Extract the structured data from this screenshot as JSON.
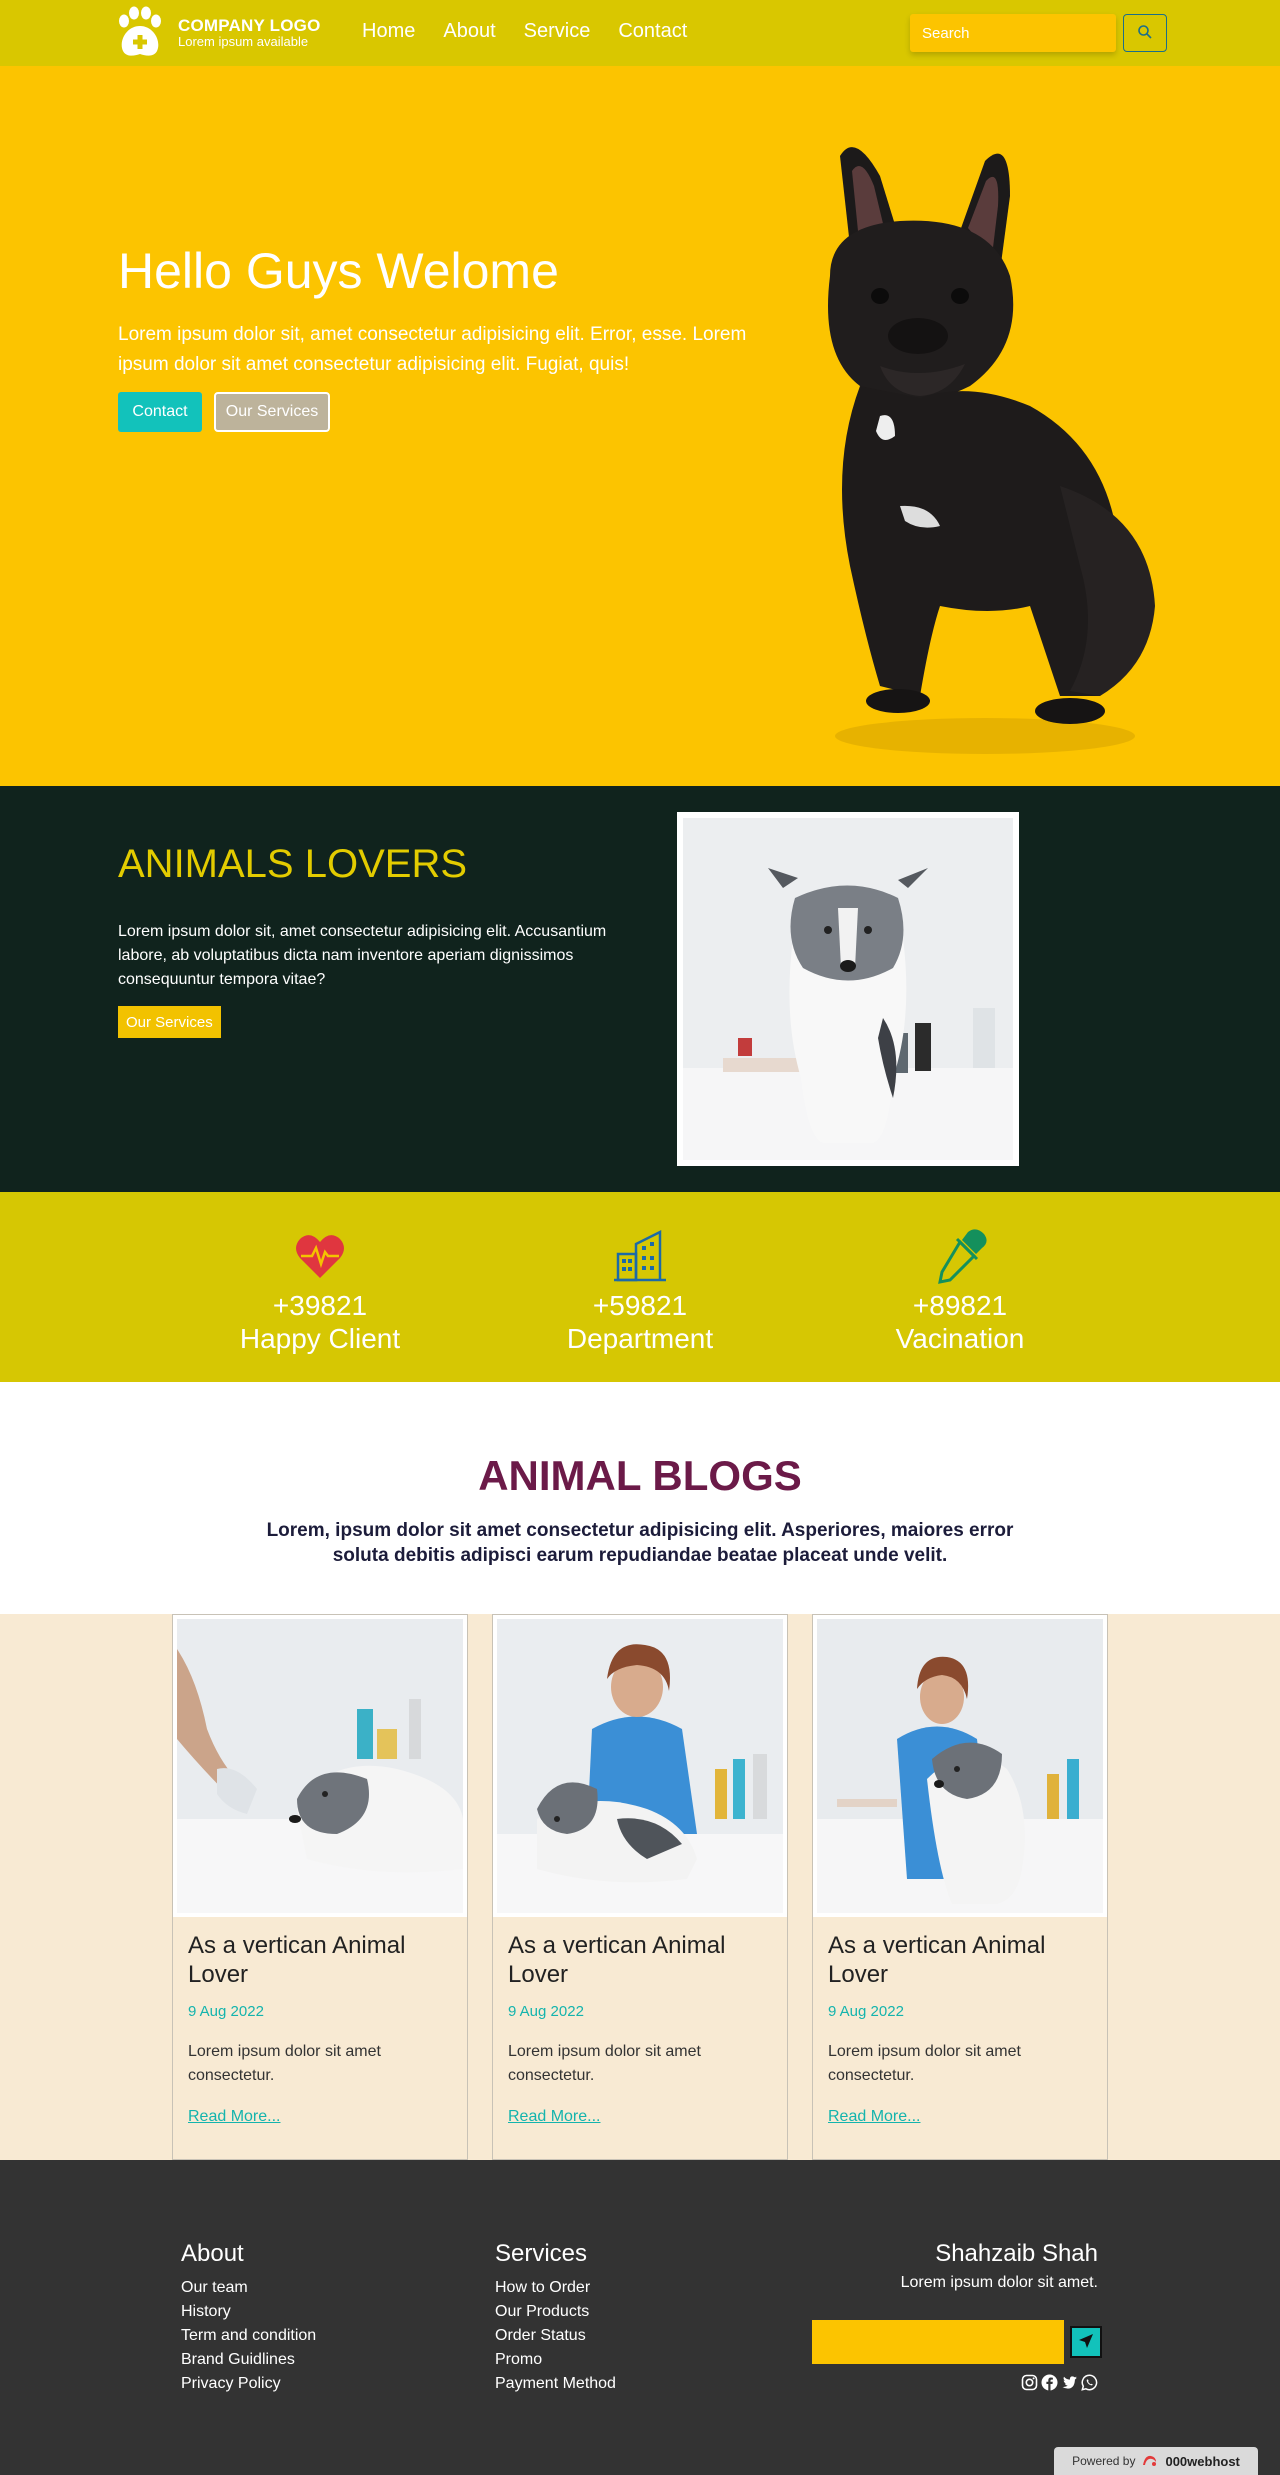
{
  "navbar": {
    "logo_title": "COMPANY LOGO",
    "logo_subtitle": "Lorem ipsum available",
    "links": [
      "Home",
      "About",
      "Service",
      "Contact"
    ],
    "search_placeholder": "Search",
    "search_icon": "search-icon"
  },
  "hero": {
    "title": "Hello Guys Welome",
    "text": "Lorem ipsum dolor sit, amet consectetur adipisicing elit. Error, esse. Lorem ipsum dolor sit amet consectetur adipisicing elit. Fugiat, quis!",
    "contact_label": "Contact",
    "services_label": "Our Services"
  },
  "lovers": {
    "title": "ANIMALS LOVERS",
    "text": "Lorem ipsum dolor sit, amet consectetur adipisicing elit. Accusantium labore, ab voluptatibus dicta nam inventore aperiam dignissimos consequuntur tempora vitae?",
    "button_label": "Our Services"
  },
  "stats": [
    {
      "icon": "heartbeat-icon",
      "number": "+39821",
      "label": "Happy Client"
    },
    {
      "icon": "building-icon",
      "number": "+59821",
      "label": "Department"
    },
    {
      "icon": "eyedropper-icon",
      "number": "+89821",
      "label": "Vacination"
    }
  ],
  "blogs": {
    "title": "ANIMAL BLOGS",
    "subtitle": "Lorem, ipsum dolor sit amet consectetur adipisicing elit. Asperiores, maiores error soluta debitis adipisci earum repudiandae beatae placeat unde velit.",
    "cards": [
      {
        "title": "As a vertican Animal Lover",
        "date": "9 Aug 2022",
        "text": "Lorem ipsum dolor sit amet consectetur.",
        "link": "Read More..."
      },
      {
        "title": "As a vertican Animal Lover",
        "date": "9 Aug 2022",
        "text": "Lorem ipsum dolor sit amet consectetur.",
        "link": "Read More..."
      },
      {
        "title": "As a vertican Animal Lover",
        "date": "9 Aug 2022",
        "text": "Lorem ipsum dolor sit amet consectetur.",
        "link": "Read More..."
      }
    ]
  },
  "footer": {
    "about_title": "About",
    "about_links": [
      "Our team",
      "History",
      "Term and condition",
      "Brand Guidlines",
      "Privacy Policy"
    ],
    "services_title": "Services",
    "services_links": [
      "How to Order",
      "Our Products",
      "Order Status",
      "Promo",
      "Payment Method"
    ],
    "author_name": "Shahzaib Shah",
    "author_text": "Lorem ipsum dolor sit amet.",
    "send_icon": "send-icon",
    "socials": [
      "instagram-icon",
      "facebook-icon",
      "twitter-icon",
      "whatsapp-icon"
    ],
    "powered_prefix": "Powered by",
    "powered_brand": "000webhost"
  },
  "colors": {
    "navbar": "#d9c700",
    "hero": "#fcc400",
    "lovers_bg": "#10231d",
    "lovers_title": "#e3cc00",
    "stats_bg": "#d6c703",
    "accent": "#12c2bb",
    "blog_title": "#6b1a48",
    "cards_bg": "#f8ead3",
    "footer_bg": "#333333"
  }
}
